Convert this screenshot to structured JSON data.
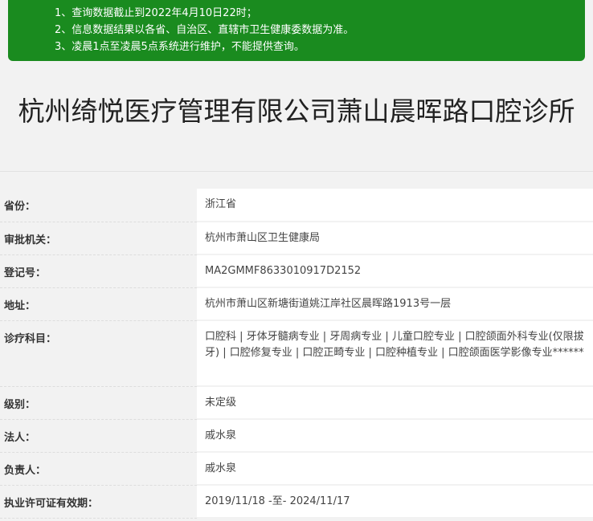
{
  "notice": {
    "lines": [
      "1、查询数据截止到2022年4月10日22时；",
      "2、信息数据结果以各省、自治区、直辖市卫生健康委数据为准。",
      "3、凌晨1点至凌晨5点系统进行维护，不能提供查询。"
    ]
  },
  "title": "杭州绮悦医疗管理有限公司萧山晨晖路口腔诊所",
  "rows": [
    {
      "label": "省份：",
      "value": "浙江省"
    },
    {
      "label": "审批机关：",
      "value": "杭州市萧山区卫生健康局"
    },
    {
      "label": "登记号：",
      "value": "MA2GMMF8633010917D2152"
    },
    {
      "label": "地址：",
      "value": "杭州市萧山区新塘街道姚江岸社区晨晖路1913号一层"
    },
    {
      "label": "诊疗科目：",
      "value": "口腔科 | 牙体牙髓病专业 | 牙周病专业 | 儿童口腔专业 | 口腔颌面外科专业(仅限拔牙) | 口腔修复专业 | 口腔正畸专业 | 口腔种植专业 | 口腔颌面医学影像专业******"
    },
    {
      "label": "级别：",
      "value": "未定级"
    },
    {
      "label": "法人：",
      "value": "戚水泉"
    },
    {
      "label": "负责人：",
      "value": "戚水泉"
    },
    {
      "label": "执业许可证有效期：",
      "value": "2019/11/18 -至- 2024/11/17"
    }
  ]
}
